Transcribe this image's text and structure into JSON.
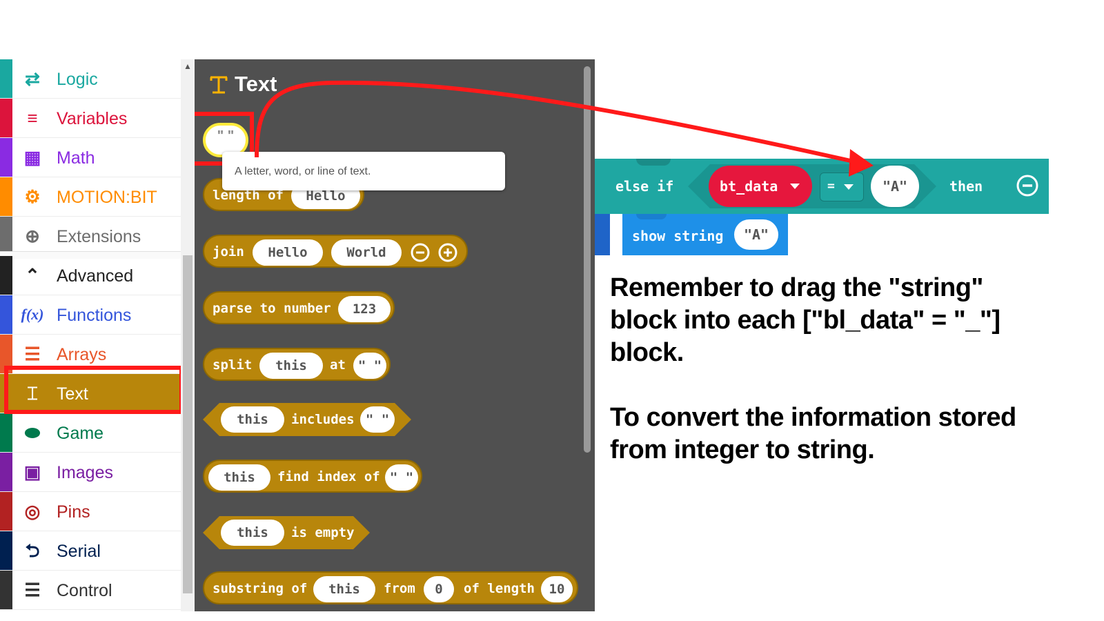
{
  "sidebar": {
    "items": [
      {
        "label": "Logic",
        "icon": "shuffle-icon",
        "color": "#1aa8a0"
      },
      {
        "label": "Variables",
        "icon": "list-icon",
        "color": "#dc143c"
      },
      {
        "label": "Math",
        "icon": "calculator-icon",
        "color": "#8a2be2"
      },
      {
        "label": "MOTION:BIT",
        "icon": "gears-icon",
        "color": "#ff8c00"
      },
      {
        "label": "Extensions",
        "icon": "plus-circle-icon",
        "color": "#6d6d6d"
      },
      {
        "label": "Advanced",
        "icon": "chevron-up-icon",
        "color": "#222222"
      },
      {
        "label": "Functions",
        "icon": "function-icon",
        "color": "#3455db"
      },
      {
        "label": "Arrays",
        "icon": "list-ordered-icon",
        "color": "#e8562a"
      },
      {
        "label": "Text",
        "icon": "text-icon",
        "color": "#b8860b"
      },
      {
        "label": "Game",
        "icon": "gamepad-icon",
        "color": "#007a4d"
      },
      {
        "label": "Images",
        "icon": "image-icon",
        "color": "#7a1fa2"
      },
      {
        "label": "Pins",
        "icon": "target-icon",
        "color": "#b22222"
      },
      {
        "label": "Serial",
        "icon": "usb-icon",
        "color": "#002050"
      },
      {
        "label": "Control",
        "icon": "server-icon",
        "color": "#333333"
      }
    ]
  },
  "flyout": {
    "title": "Text",
    "string_block": "\" \"",
    "tooltip": "A letter, word, or line of text.",
    "blocks": {
      "length_of": {
        "label": "length of",
        "arg": "Hello"
      },
      "join": {
        "label": "join",
        "arg1": "Hello",
        "arg2": "World"
      },
      "parse": {
        "label": "parse to number",
        "arg": "123"
      },
      "split": {
        "label": "split",
        "arg1": "this",
        "mid": "at",
        "arg2": "\" \""
      },
      "includes": {
        "arg1": "this",
        "label": "includes",
        "arg2": "\" \""
      },
      "find_index": {
        "arg1": "this",
        "label": "find index of",
        "arg2": "\" \""
      },
      "is_empty": {
        "arg1": "this",
        "label": "is empty"
      },
      "substring": {
        "label": "substring of",
        "arg1": "this",
        "from": "from",
        "arg2": "0",
        "of_length": "of length",
        "arg3": "10"
      }
    }
  },
  "code": {
    "else_if": "else if",
    "var": "bt_data",
    "op": "=",
    "value": "\"A\"",
    "then": "then",
    "show_string": "show string",
    "show_value": "\"A\""
  },
  "notes": {
    "line1": "Remember to drag the \"string\"",
    "line2": "block into each [\"bl_data\" = \"_\"]",
    "line3": "block.",
    "line4": "To convert the information stored",
    "line5": "from integer to string."
  }
}
